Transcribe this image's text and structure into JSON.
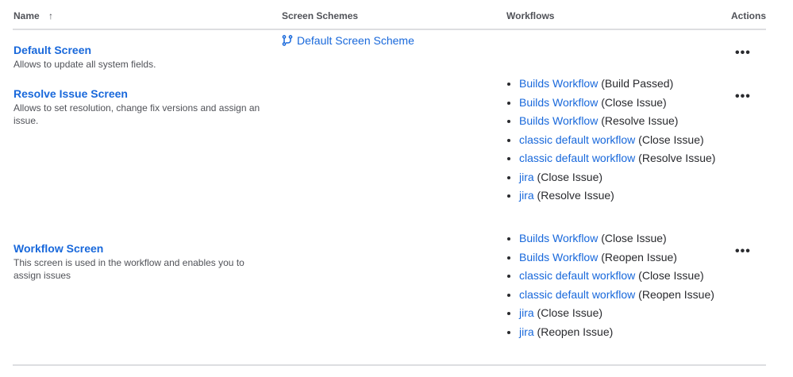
{
  "headers": {
    "name": "Name",
    "screen_schemes": "Screen Schemes",
    "workflows": "Workflows",
    "actions": "Actions"
  },
  "rows": [
    {
      "title": "Default Screen",
      "desc": "Allows to update all system fields.",
      "scheme": "Default Screen Scheme",
      "workflows": []
    },
    {
      "title": "Resolve Issue Screen",
      "desc": "Allows to set resolution, change fix versions and assign an issue.",
      "workflows": [
        {
          "link": "Builds Workflow",
          "trans": " (Build Passed)"
        },
        {
          "link": "Builds Workflow",
          "trans": " (Close Issue)"
        },
        {
          "link": "Builds Workflow",
          "trans": " (Resolve Issue)"
        },
        {
          "link": "classic default workflow",
          "trans": " (Close Issue)"
        },
        {
          "link": "classic default workflow",
          "trans": " (Resolve Issue)"
        },
        {
          "link": "jira",
          "trans": " (Close Issue)"
        },
        {
          "link": "jira",
          "trans": " (Resolve Issue)"
        }
      ]
    },
    {
      "title": "Workflow Screen",
      "desc": "This screen is used in the workflow and enables you to assign issues",
      "workflows": [
        {
          "link": "Builds Workflow",
          "trans": " (Close Issue)"
        },
        {
          "link": "Builds Workflow",
          "trans": " (Reopen Issue)"
        },
        {
          "link": "classic default workflow",
          "trans": " (Close Issue)"
        },
        {
          "link": "classic default workflow",
          "trans": " (Reopen Issue)"
        },
        {
          "link": "jira",
          "trans": " (Close Issue)"
        },
        {
          "link": "jira",
          "trans": " (Reopen Issue)"
        }
      ]
    }
  ],
  "actions_label": "•••"
}
